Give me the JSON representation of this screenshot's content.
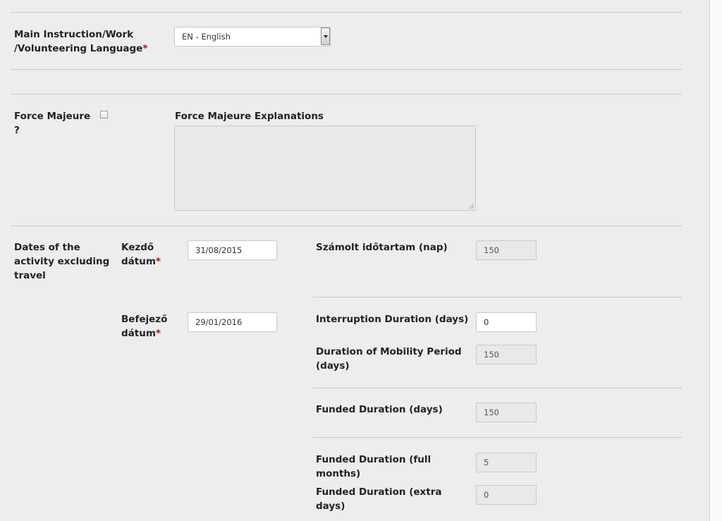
{
  "language": {
    "label": "Main Instruction/Work /Volunteering Language",
    "label_line1": "Main Instruction/Work",
    "label_line2": "/Volunteering Language",
    "required_mark": "*",
    "selected": "EN - English"
  },
  "force_majeure": {
    "label_line1": "Force Majeure",
    "label_line2": "?",
    "checked": false,
    "explanations_label": "Force Majeure Explanations",
    "explanations_value": ""
  },
  "dates": {
    "section_label_line1": "Dates of the",
    "section_label_line2": "activity excluding",
    "section_label_line3": "travel",
    "start_label_line1": "Kezdő",
    "start_label_line2": "dátum",
    "start_value": "31/08/2015",
    "end_label_line1": "Befejező",
    "end_label_line2": "dátum",
    "end_value": "29/01/2016",
    "required_mark": "*"
  },
  "durations": {
    "calculated_label": "Számolt időtartam (nap)",
    "calculated_value": "150",
    "interruption_label": "Interruption Duration (days)",
    "interruption_value": "0",
    "mobility_label_line1": "Duration of Mobility Period",
    "mobility_label_line2": "(days)",
    "mobility_value": "150",
    "funded_label": "Funded Duration (days)",
    "funded_value": "150",
    "funded_months_label_line1": "Funded Duration (full",
    "funded_months_label_line2": "months)",
    "funded_months_value": "5",
    "funded_extra_label_line1": "Funded Duration (extra",
    "funded_extra_label_line2": "days)",
    "funded_extra_value": "0"
  }
}
